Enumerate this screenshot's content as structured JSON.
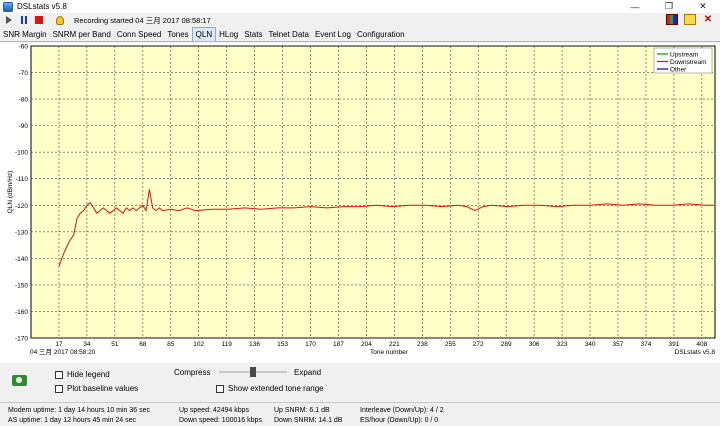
{
  "window": {
    "title": "DSLstats v5.8",
    "minimize": "—",
    "maximize": "❐",
    "close": "✕"
  },
  "toolbar": {
    "recording": "Recording started 04 三月 2017 08:58:17"
  },
  "tabs": [
    "SNR Margin",
    "SNRM per Band",
    "Conn Speed",
    "Tones",
    "QLN",
    "HLog",
    "Stats",
    "Telnet Data",
    "Event Log",
    "Configuration"
  ],
  "active_tab": "QLN",
  "chart_data": {
    "type": "line",
    "ylabel": "QLN (dBm/Hz)",
    "xlabel": "Tone number",
    "ylim": [
      -170,
      -60
    ],
    "yticks": [
      "-60",
      "-70",
      "-80",
      "-90",
      "-100",
      "-110",
      "-120",
      "-130",
      "-140",
      "-150",
      "-160",
      "-170"
    ],
    "xlim": [
      0,
      416
    ],
    "xticks": [
      "17",
      "34",
      "51",
      "68",
      "85",
      "102",
      "119",
      "136",
      "153",
      "170",
      "187",
      "204",
      "221",
      "238",
      "255",
      "272",
      "289",
      "306",
      "323",
      "340",
      "357",
      "374",
      "391",
      "408"
    ],
    "grid": true,
    "background": "#ffffc8",
    "timestamp": "04 三月 2017 08:58:20",
    "watermark": "DSLstats v5.8",
    "legend_placement": "top-right",
    "series": [
      {
        "name": "Upstream",
        "color": "#00a000",
        "x": [],
        "y": []
      },
      {
        "name": "Downstream",
        "color": "#e01010",
        "x": [
          17,
          20,
          23,
          26,
          28,
          30,
          32,
          34,
          36,
          38,
          40,
          42,
          44,
          46,
          48,
          50,
          52,
          54,
          56,
          58,
          60,
          62,
          64,
          66,
          68,
          70,
          72,
          74,
          76,
          78,
          80,
          85,
          90,
          95,
          100,
          110,
          120,
          130,
          140,
          150,
          160,
          170,
          180,
          190,
          200,
          210,
          220,
          230,
          240,
          250,
          260,
          265,
          270,
          275,
          280,
          290,
          300,
          310,
          320,
          330,
          340,
          350,
          360,
          370,
          380,
          390,
          400,
          410,
          416
        ],
        "y": [
          -143,
          -138,
          -134,
          -131,
          -125,
          -123,
          -122,
          -120,
          -119,
          -121,
          -123,
          -122,
          -121,
          -122,
          -123,
          -122,
          -121,
          -122,
          -123,
          -121,
          -122,
          -121,
          -122,
          -121,
          -120,
          -122,
          -114,
          -121,
          -122,
          -121,
          -122,
          -121.5,
          -122,
          -121,
          -122,
          -121.5,
          -121.5,
          -121,
          -121.5,
          -121,
          -121,
          -120.5,
          -121,
          -120.5,
          -120.5,
          -120,
          -120.5,
          -120,
          -120,
          -120.5,
          -120,
          -120.5,
          -122,
          -120.5,
          -120,
          -120.5,
          -120,
          -120,
          -120.5,
          -120,
          -120,
          -119.5,
          -120,
          -119.5,
          -120,
          -120,
          -119.5,
          -120,
          -120
        ]
      },
      {
        "name": "Other",
        "color": "#0000c0",
        "x": [],
        "y": []
      }
    ]
  },
  "controls": {
    "hide_legend": "Hide legend",
    "plot_baseline": "Plot baseline values",
    "compress": "Compress",
    "expand": "Expand",
    "show_extended": "Show extended tone range"
  },
  "status": {
    "modem_uptime": "Modem uptime: 1 day 14 hours 10 min 36 sec",
    "as_uptime": "AS uptime: 1 day 12 hours 45 min 24 sec",
    "up_speed": "Up speed: 42494 kbps",
    "down_speed": "Down speed: 100016 kbps",
    "up_snrm": "Up SNRM: 6.1 dB",
    "down_snrm": "Down SNRM: 14.1 dB",
    "interleave": "Interleave (Down/Up): 4 / 2",
    "es_hour": "ES/hour (Down/Up): 0 / 0"
  }
}
